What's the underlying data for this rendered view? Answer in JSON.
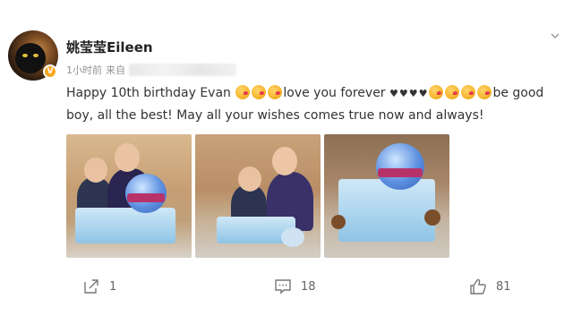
{
  "user": {
    "name": "姚莹莹Eileen",
    "time": "1小时前",
    "source_prefix": "来自",
    "verified_badge": "V"
  },
  "post": {
    "line1_a": "Happy 10th birthday Evan ",
    "line1_b": "love you forever ",
    "hearts": "♥♥♥♥",
    "line1_c": "be good",
    "line2": "boy, all the best! May all your wishes comes true now and always!"
  },
  "photos": [
    {
      "label": "birthday-photo-1"
    },
    {
      "label": "birthday-photo-2"
    },
    {
      "label": "birthday-cake-photo"
    }
  ],
  "actions": {
    "share_count": "1",
    "comment_count": "18",
    "like_count": "81"
  },
  "colors": {
    "text": "#333333",
    "meta": "#939393",
    "badge": "#f5a623"
  }
}
